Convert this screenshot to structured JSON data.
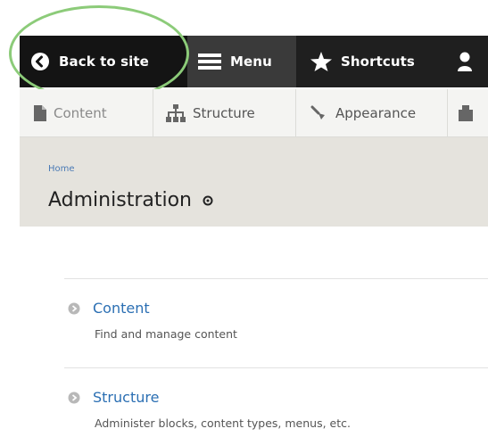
{
  "toolbar": {
    "back_label": "Back to site",
    "menu_label": "Menu",
    "shortcuts_label": "Shortcuts"
  },
  "tray": {
    "items": [
      {
        "label": "Content"
      },
      {
        "label": "Structure"
      },
      {
        "label": "Appearance"
      }
    ]
  },
  "header": {
    "breadcrumb": "Home",
    "title": "Administration"
  },
  "list": [
    {
      "title": "Content",
      "description": "Find and manage content"
    },
    {
      "title": "Structure",
      "description": "Administer blocks, content types, menus, etc."
    }
  ],
  "colors": {
    "toolbar_bg": "#1f1f1f",
    "highlight": "#8ccb79",
    "link": "#2b6fb3",
    "header_bg": "#e5e3dd"
  }
}
